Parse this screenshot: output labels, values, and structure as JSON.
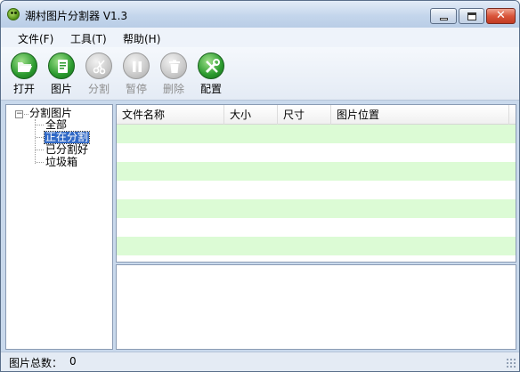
{
  "window": {
    "title": "潮村图片分割器 V1.3"
  },
  "menu": [
    {
      "label": "文件(F)"
    },
    {
      "label": "工具(T)"
    },
    {
      "label": "帮助(H)"
    }
  ],
  "toolbar": [
    {
      "label": "打开",
      "icon": "folder-open-icon",
      "enabled": true
    },
    {
      "label": "图片",
      "icon": "image-icon",
      "enabled": true
    },
    {
      "label": "分割",
      "icon": "scissors-icon",
      "enabled": false
    },
    {
      "label": "暂停",
      "icon": "pause-icon",
      "enabled": false
    },
    {
      "label": "删除",
      "icon": "trash-icon",
      "enabled": false
    },
    {
      "label": "配置",
      "icon": "tools-icon",
      "enabled": true
    }
  ],
  "tree": {
    "root": "分割图片",
    "children": [
      {
        "label": "全部",
        "selected": false
      },
      {
        "label": "正在分割",
        "selected": true
      },
      {
        "label": "已分割好",
        "selected": false
      },
      {
        "label": "垃圾箱",
        "selected": false
      }
    ]
  },
  "list": {
    "columns": [
      "文件名称",
      "大小",
      "尺寸",
      "图片位置"
    ],
    "rows": [],
    "alt_row_color": "#dcfbd5"
  },
  "status": {
    "label": "图片总数：",
    "value": "0"
  },
  "colors": {
    "accent_green": "#2b9a2e",
    "selection": "#3169c6",
    "close_red": "#c23b22"
  }
}
